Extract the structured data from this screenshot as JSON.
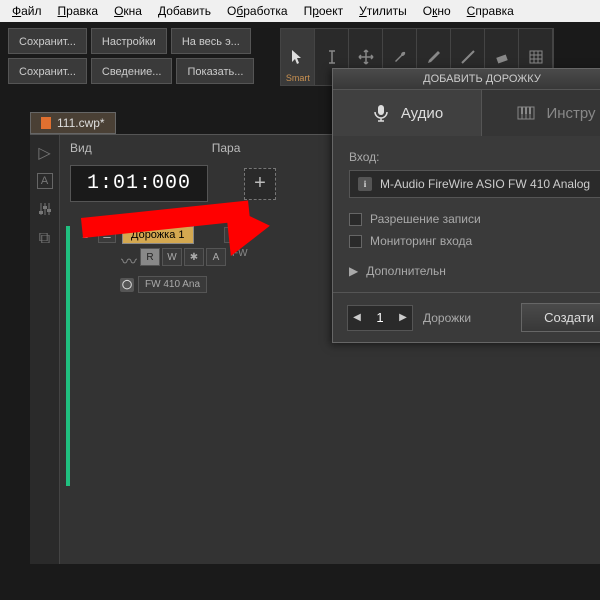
{
  "menu": [
    "Файл",
    "Правка",
    "Окна",
    "Добавить",
    "Обработка",
    "Проект",
    "Утилиты",
    "Окно",
    "Справка"
  ],
  "menu_underline": [
    0,
    0,
    0,
    0,
    1,
    0,
    0,
    0,
    0
  ],
  "toolbar": {
    "row1": [
      "Сохранит...",
      "Настройки",
      "На весь э..."
    ],
    "row2": [
      "Сохранит...",
      "Сведение...",
      "Показать..."
    ]
  },
  "tools": {
    "smart": "Smart"
  },
  "doc": {
    "title": "111.cwp*"
  },
  "panel": {
    "view": "Вид",
    "params": "Пара"
  },
  "time": "1:01:000",
  "track": {
    "num": "1",
    "name": "Дорожка 1",
    "m": "M",
    "r": "R",
    "w": "W",
    "star": "✱",
    "a": "A",
    "fw_side": "FW",
    "fw_label": "FW 410 Ana"
  },
  "dialog": {
    "title": "ДОБАВИТЬ ДОРОЖКУ",
    "tab_audio": "Аудио",
    "tab_instr": "Инстру",
    "input_label": "Вход:",
    "input_value": "M-Audio FireWire ASIO FW 410 Analog",
    "chk1": "Разрешение записи",
    "chk2": "Мониторинг входа",
    "expand": "Дополнительн",
    "count": "1",
    "tracks_label": "Дорожки",
    "create": "Создати"
  }
}
